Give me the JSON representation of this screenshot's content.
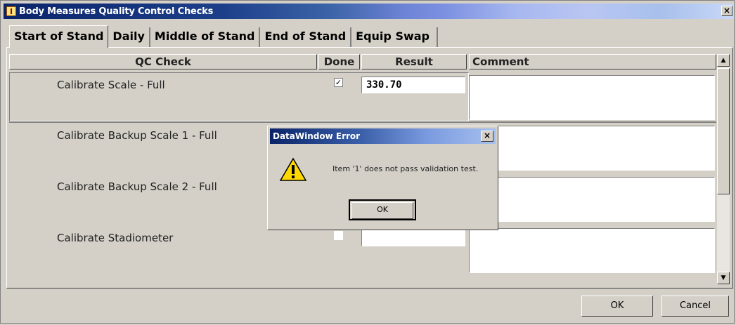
{
  "window": {
    "title": "Body Measures Quality Control Checks",
    "close_glyph": "×"
  },
  "tabs": [
    {
      "label": "Start of Stand",
      "active": true
    },
    {
      "label": "Daily",
      "active": false
    },
    {
      "label": "Middle of Stand",
      "active": false
    },
    {
      "label": "End of Stand",
      "active": false
    },
    {
      "label": "Equip Swap",
      "active": false
    }
  ],
  "grid": {
    "columns": [
      "QC Check",
      "Done",
      "Result",
      "Comment"
    ],
    "rows": [
      {
        "label": "Calibrate Scale - Full",
        "done": "✓",
        "result": "330.70",
        "comment": ""
      },
      {
        "label": "Calibrate Backup Scale 1 - Full",
        "done": "",
        "result": "",
        "comment": ""
      },
      {
        "label": "Calibrate Backup Scale 2 - Full",
        "done": "",
        "result": "",
        "comment": ""
      },
      {
        "label": "Calibrate Stadiometer",
        "done": "",
        "result": "",
        "comment": ""
      }
    ]
  },
  "scrollbar": {
    "up_glyph": "▲",
    "down_glyph": "▼"
  },
  "buttons": {
    "ok": "OK",
    "cancel": "Cancel"
  },
  "dialog": {
    "title": "DataWindow Error",
    "message": "Item '1' does not pass validation test.",
    "ok": "OK",
    "close_glyph": "×",
    "icon": "warning-icon"
  },
  "colors": {
    "titlebar": "#0a246a",
    "face": "#d4d0c8",
    "warning": "#ffd800"
  }
}
